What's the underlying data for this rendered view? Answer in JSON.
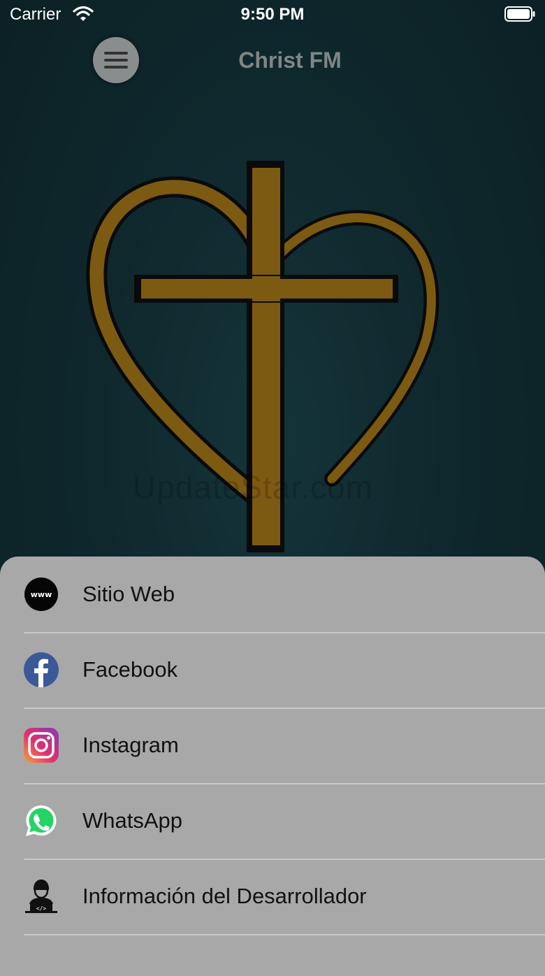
{
  "status_bar": {
    "carrier": "Carrier",
    "time": "9:50 PM"
  },
  "header": {
    "title": "Christ FM",
    "menu_icon": "hamburger-icon"
  },
  "watermark": "UpdateStar.com",
  "menu": {
    "items": [
      {
        "label": "Sitio Web",
        "icon": "www-icon"
      },
      {
        "label": "Facebook",
        "icon": "facebook-icon"
      },
      {
        "label": "Instagram",
        "icon": "instagram-icon"
      },
      {
        "label": "WhatsApp",
        "icon": "whatsapp-icon"
      },
      {
        "label": "Información del Desarrollador",
        "icon": "developer-icon"
      }
    ]
  },
  "colors": {
    "background": "#0d2226",
    "logo_gold": "#7d5a12",
    "sheet": "#a8a8a8"
  }
}
